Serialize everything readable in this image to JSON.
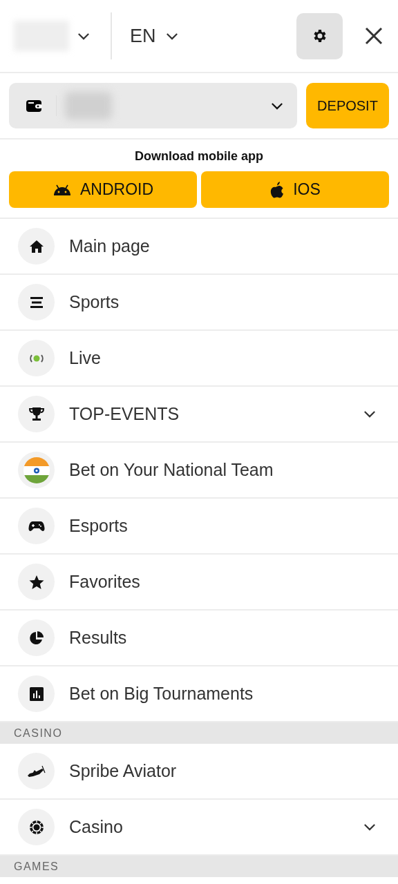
{
  "header": {
    "language": "EN"
  },
  "wallet": {
    "deposit_button": "DEPOSIT"
  },
  "download": {
    "title": "Download mobile app",
    "buttons": [
      {
        "label": "ANDROID",
        "kind": "android"
      },
      {
        "label": "IOS",
        "kind": "apple"
      }
    ]
  },
  "sections": [
    {
      "items": [
        {
          "label": "Main page",
          "kind": "home",
          "expandable": false
        },
        {
          "label": "Sports",
          "kind": "lines",
          "expandable": false
        },
        {
          "label": "Live",
          "kind": "live",
          "expandable": false
        },
        {
          "label": "TOP-EVENTS",
          "kind": "trophy",
          "expandable": true
        },
        {
          "label": "Bet on Your National Team",
          "kind": "flag",
          "expandable": false
        },
        {
          "label": "Esports",
          "kind": "gamepad",
          "expandable": false
        },
        {
          "label": "Favorites",
          "kind": "star",
          "expandable": false
        },
        {
          "label": "Results",
          "kind": "pie",
          "expandable": false
        },
        {
          "label": "Bet on Big Tournaments",
          "kind": "chart",
          "expandable": false
        }
      ]
    },
    {
      "title": "CASINO",
      "items": [
        {
          "label": "Spribe Aviator",
          "kind": "plane",
          "expandable": false
        },
        {
          "label": "Casino",
          "kind": "chip",
          "expandable": true
        }
      ]
    },
    {
      "title": "GAMES"
    }
  ]
}
